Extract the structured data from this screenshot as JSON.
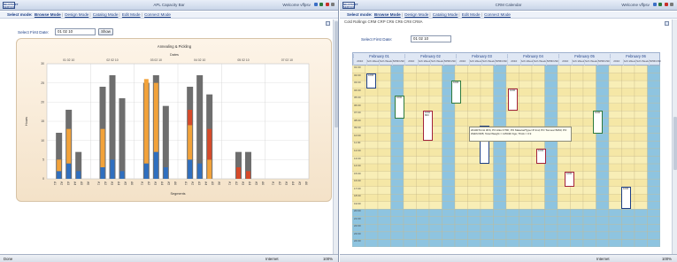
{
  "left": {
    "logo": "NEARSOFT\nSERVICE",
    "window_title": "APL Capacity Bar",
    "welcome": "Welcome vffpsv",
    "menu": {
      "prefix": "Select mode:",
      "items": [
        "Browse Mode",
        "Design Mode",
        "Catalog Mode",
        "Edit Mode",
        "Connect Mode"
      ],
      "selected": 0
    },
    "form": {
      "label": "Select First Date:",
      "value": "01 02 10",
      "button": "Show"
    },
    "status": {
      "left": "Done",
      "zone": "Internet",
      "zoom": "100%"
    }
  },
  "right": {
    "logo": "NEARSOFT\nSERVICE",
    "window_title": "CRM Calendar",
    "welcome": "Welcome vffpsv",
    "menu": {
      "prefix": "Select mode:",
      "items": [
        "Browse Mode",
        "Design Mode",
        "Catalog Mode",
        "Edit Mode",
        "Connect Mode"
      ],
      "selected": 0
    },
    "subtitle": "Cold Rollings CRM CRP CR6 CR6 CR8 CR8A",
    "form": {
      "label": "Select First Date:",
      "value": "01 02 10"
    },
    "days": [
      "February 01",
      "February 02",
      "February 03",
      "February 04",
      "February 05",
      "February 06"
    ],
    "sub_headers": [
      "2010",
      "Sch.Week",
      "Sch.Week",
      "BPM/USD"
    ],
    "tooltip": "2010071CH 3KS; PO Alloc=ITRI; PO Material/Type=P 2nd; PO Tonnes=5260; PO Width=965; Total Weight = 125430 Kgs; Thick = 0.9",
    "status": {
      "zone": "Internet",
      "zoom": "100%"
    }
  },
  "chart_data": {
    "type": "bar",
    "title": "Annealing & Pickling",
    "subtitle": "Dates",
    "ylabel": "Hours",
    "xlabel": "Segments",
    "ylim": [
      0,
      30
    ],
    "yticks": [
      0,
      5,
      10,
      15,
      20,
      25,
      30
    ],
    "groups": [
      "01 02 10",
      "02 02 10",
      "03 02 10",
      "04 02 10",
      "05 02 10",
      "07 02 10"
    ],
    "segment_labels": [
      "A1",
      "A2",
      "A3",
      "A4",
      "A5",
      "A6"
    ],
    "colors": {
      "capacity": "#6e6e6e",
      "used": "#f2a23a",
      "other": "#2f6fbf",
      "red": "#d54a2a"
    },
    "bars": [
      {
        "group": 0,
        "capacity": 12,
        "used": 3,
        "other": 2,
        "red": 0
      },
      {
        "group": 0,
        "capacity": 18,
        "used": 9,
        "other": 4,
        "red": 0
      },
      {
        "group": 0,
        "capacity": 7,
        "used": 0,
        "other": 2,
        "red": 0
      },
      {
        "group": 1,
        "capacity": 24,
        "used": 10,
        "other": 3,
        "red": 0
      },
      {
        "group": 1,
        "capacity": 27,
        "used": 0,
        "other": 5,
        "red": 0
      },
      {
        "group": 1,
        "capacity": 21,
        "used": 0,
        "other": 2,
        "red": 0
      },
      {
        "group": 2,
        "capacity": 25,
        "used": 22,
        "other": 4,
        "red": 0
      },
      {
        "group": 2,
        "capacity": 27,
        "used": 18,
        "other": 7,
        "red": 0
      },
      {
        "group": 2,
        "capacity": 19,
        "used": 0,
        "other": 3,
        "red": 0
      },
      {
        "group": 3,
        "capacity": 24,
        "used": 9,
        "other": 5,
        "red": 4
      },
      {
        "group": 3,
        "capacity": 27,
        "used": 0,
        "other": 4,
        "red": 0
      },
      {
        "group": 3,
        "capacity": 22,
        "used": 5,
        "other": 0,
        "red": 8
      },
      {
        "group": 4,
        "capacity": 7,
        "used": 0,
        "other": 0,
        "red": 3
      },
      {
        "group": 4,
        "capacity": 7,
        "used": 0,
        "other": 0,
        "red": 2
      }
    ]
  },
  "calendar": {
    "row_labels": [
      "01:00",
      "02:00",
      "03:00",
      "04:00",
      "05:00",
      "06:00",
      "07:00",
      "08:00",
      "09:00",
      "10:00",
      "11:00",
      "12:00",
      "13:00",
      "14:00",
      "15:00",
      "16:00",
      "17:00",
      "18:00",
      "19:00",
      "20:00",
      "21:00",
      "22:00",
      "23:00",
      "24:00"
    ],
    "bookings": [
      {
        "col": 0,
        "row": 1,
        "h": 2,
        "kind": "blue",
        "text": "1000"
      },
      {
        "col": 1,
        "row": 4,
        "h": 3,
        "kind": "green",
        "text": "1000"
      },
      {
        "col": 2,
        "row": 6,
        "h": 4,
        "kind": "red",
        "text": "1000\n800"
      },
      {
        "col": 3,
        "row": 2,
        "h": 3,
        "kind": "green",
        "text": "1000"
      },
      {
        "col": 4,
        "row": 8,
        "h": 5,
        "kind": "blue",
        "text": "1000\n800\n1000"
      },
      {
        "col": 5,
        "row": 3,
        "h": 3,
        "kind": "red",
        "text": "1000"
      },
      {
        "col": 6,
        "row": 11,
        "h": 2,
        "kind": "red",
        "text": "1000"
      },
      {
        "col": 7,
        "row": 14,
        "h": 2,
        "kind": "red",
        "text": "1000"
      },
      {
        "col": 8,
        "row": 6,
        "h": 3,
        "kind": "green",
        "text": "1000"
      },
      {
        "col": 9,
        "row": 16,
        "h": 3,
        "kind": "blue",
        "text": "1000"
      }
    ]
  }
}
